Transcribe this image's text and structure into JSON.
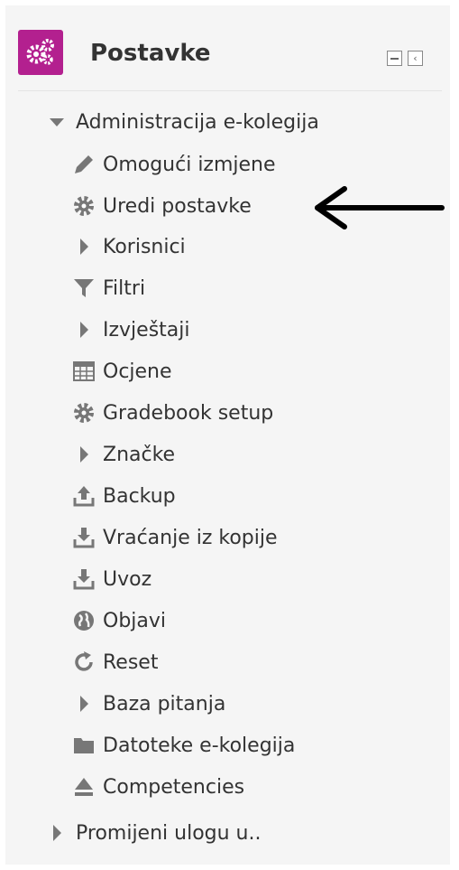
{
  "block": {
    "title": "Postavke",
    "controls": {
      "minimize_icon": "minimize-icon",
      "dock_icon": "dock-icon"
    }
  },
  "tree": {
    "root": {
      "label": "Administracija e-kolegija",
      "icon": "caret-down-icon",
      "expanded": true
    },
    "items": [
      {
        "label": "Omogući izmjene",
        "icon": "pencil-icon"
      },
      {
        "label": "Uredi postavke",
        "icon": "gear-icon"
      },
      {
        "label": "Korisnici",
        "icon": "caret-right-icon"
      },
      {
        "label": "Filtri",
        "icon": "filter-icon"
      },
      {
        "label": "Izvještaji",
        "icon": "caret-right-icon"
      },
      {
        "label": "Ocjene",
        "icon": "table-icon"
      },
      {
        "label": "Gradebook setup",
        "icon": "gear-icon"
      },
      {
        "label": "Značke",
        "icon": "caret-right-icon"
      },
      {
        "label": "Backup",
        "icon": "upload-icon"
      },
      {
        "label": "Vraćanje iz kopije",
        "icon": "download-icon"
      },
      {
        "label": "Uvoz",
        "icon": "download-icon"
      },
      {
        "label": "Objavi",
        "icon": "globe-icon"
      },
      {
        "label": "Reset",
        "icon": "refresh-icon"
      },
      {
        "label": "Baza pitanja",
        "icon": "caret-right-icon"
      },
      {
        "label": "Datoteke e-kolegija",
        "icon": "folder-icon"
      },
      {
        "label": "Competencies",
        "icon": "eject-icon"
      }
    ],
    "footer": {
      "label": "Promijeni ulogu u..",
      "icon": "caret-right-icon"
    }
  },
  "annotation": {
    "icon": "left-arrow-icon",
    "points_to": "Uredi postavke"
  },
  "colors": {
    "logo": "#b3208f",
    "icon": "#777777",
    "text": "#333333",
    "panel": "#f5f5f5"
  }
}
